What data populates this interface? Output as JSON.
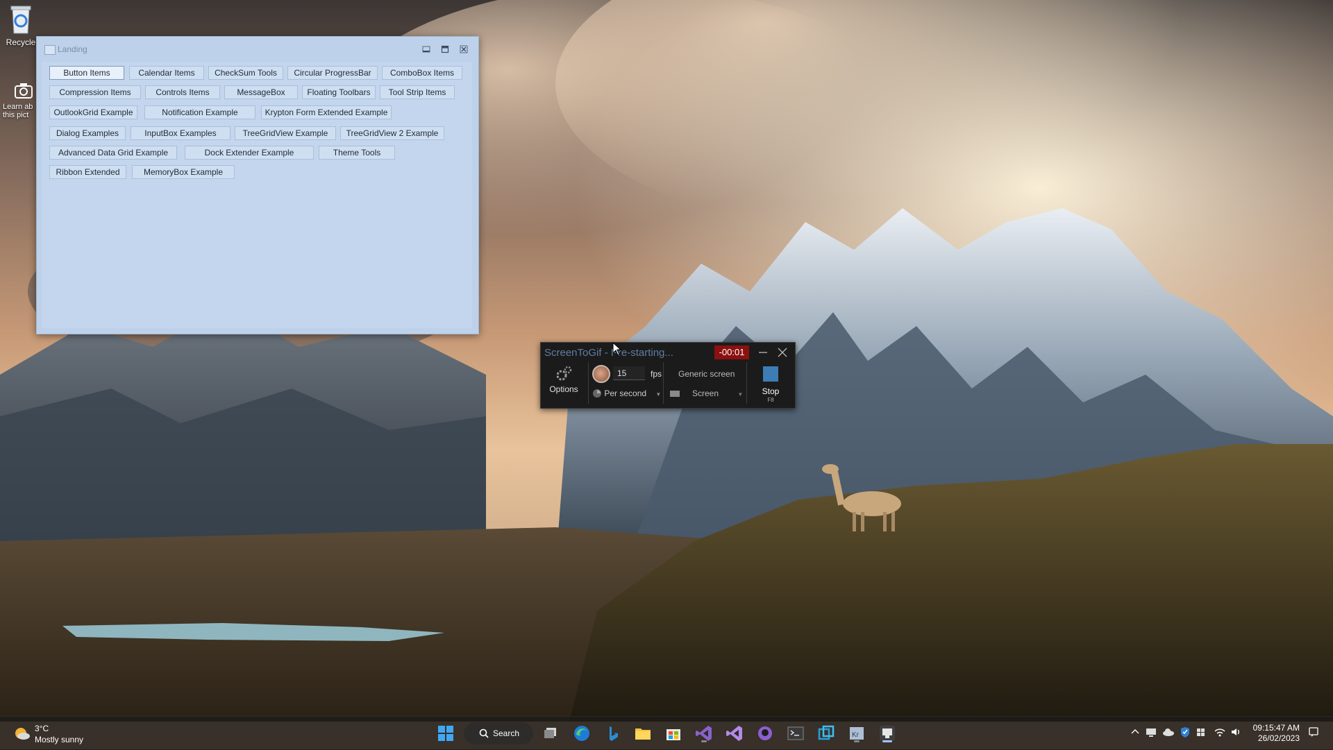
{
  "desktop": {
    "icons": [
      {
        "label": "Recycle"
      },
      {
        "label": "Learn ab\nthis pict"
      }
    ]
  },
  "landing": {
    "title": "Landing",
    "buttons": [
      "Button Items",
      "Calendar Items",
      "CheckSum Tools",
      "Circular ProgressBar",
      "ComboBox Items",
      "Compression Items",
      "Controls Items",
      "MessageBox",
      "Floating Toolbars",
      "Tool Strip Items",
      "OutlookGrid Example",
      "Notification Example",
      "Krypton Form Extended Example",
      "Dialog Examples",
      "InputBox Examples",
      "TreeGridView Example",
      "TreeGridView 2 Example",
      "Advanced Data Grid Example",
      "Dock Extender Example",
      "Theme Tools",
      "Ribbon Extended",
      "MemoryBox Example"
    ],
    "selected": "Button Items"
  },
  "screentogif": {
    "title": "ScreenToGif - Pre-starting...",
    "timer": "-00:01",
    "options_label": "Options",
    "fps_value": "15",
    "fps_label": "fps",
    "frequency": "Per second",
    "mode": "Generic screen",
    "screen_label": "Screen",
    "stop_label": "Stop",
    "stop_key": "F8"
  },
  "taskbar": {
    "weather_temp": "3°C",
    "weather_cond": "Mostly sunny",
    "search_label": "Search",
    "time": "09:15:47 AM",
    "date": "26/02/2023",
    "apps": [
      "start-icon",
      "search-icon",
      "task-view-icon",
      "edge-icon",
      "bing-icon",
      "file-explorer-icon",
      "store-icon",
      "visual-studio-icon",
      "visual-studio-preview-icon",
      "github-desktop-icon",
      "terminal-icon",
      "snipping-icon",
      "krypton-app-icon",
      "screentogif-icon"
    ]
  }
}
